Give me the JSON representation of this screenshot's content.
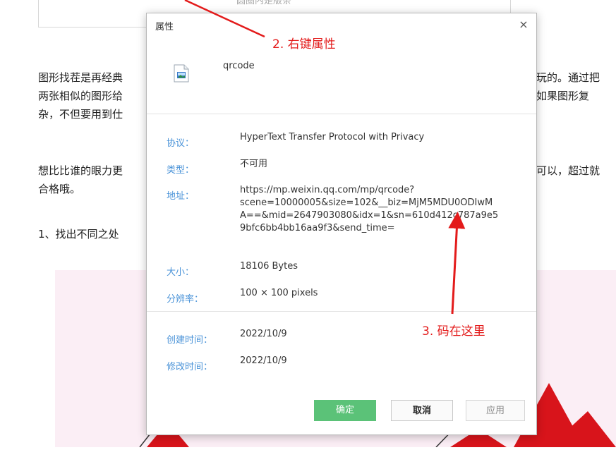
{
  "article": {
    "top_box_text": "圆圈内是版条",
    "para1_line1_left": "图形找茬是再经典",
    "para1_line1_right": "玩的。通过把",
    "para1_line2_left": "两张相似的图形给",
    "para1_line2_right": "如果图形复",
    "para1_line3_left": "杂，不但要用到仕",
    "para2_line1_left": "想比比谁的眼力更",
    "para2_line1_right": "可以，超过就",
    "para2_line2_left": "合格哦。",
    "para3_left": "1、找出不同之处"
  },
  "dialog": {
    "title": "属性",
    "close_glyph": "×",
    "file_name": "qrcode",
    "protocol_label": "协议：",
    "protocol_value": "HyperText Transfer Protocol with Privacy",
    "type_label": "类型：",
    "type_value": "不可用",
    "address_label": "地址：",
    "address_lines": [
      "https://mp.weixin.qq.com/mp/qrcode?",
      "scene=10000005&size=102&__biz=MjM5MDU0ODIwM",
      "A==&mid=2647903080&idx=1&sn=610d412c787a9e5",
      "9bfc6bb4bb16aa9f3&send_time="
    ],
    "size_label": "大小：",
    "size_value": "18106 Bytes",
    "resolution_label": "分辨率：",
    "resolution_value": "100 × 100 pixels",
    "created_label": "创建时间：",
    "created_value": "2022/10/9",
    "modified_label": "修改时间：",
    "modified_value": "2022/10/9",
    "ok_button": "确定",
    "cancel_button": "取消",
    "apply_button": "应用"
  },
  "annotations": {
    "step2": "2. 右键属性",
    "step3": "3. 码在这里"
  },
  "colors": {
    "label_blue": "#4a93d8",
    "ok_green": "#5bc278",
    "annotation_red": "#e31b1b",
    "pink_background": "#fbeef5"
  }
}
